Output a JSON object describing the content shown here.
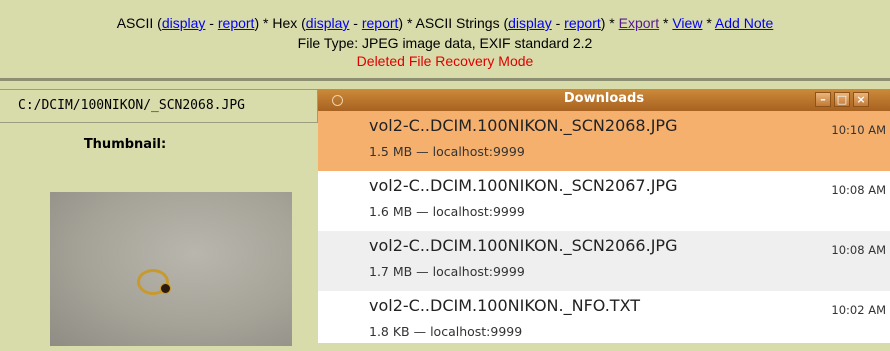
{
  "header": {
    "ascii": "ASCII (",
    "ascii_display": "display",
    "dash1": " - ",
    "ascii_report": "report",
    "hex": ") * Hex (",
    "hex_display": "display",
    "dash2": " - ",
    "hex_report": "report",
    "strings": ") * ASCII Strings (",
    "strings_display": "display",
    "dash3": " - ",
    "strings_report": "report",
    "close_paren": ") * ",
    "export": "Export",
    "star1": " * ",
    "view": "View",
    "star2": " * ",
    "add_note": "Add Note",
    "file_type": "File Type: JPEG image data, EXIF standard 2.2",
    "mode": "Deleted File Recovery Mode"
  },
  "left": {
    "path": "C:/DCIM/100NIKON/_SCN2068.JPG",
    "thumbnail_label": "Thumbnail:"
  },
  "downloads": {
    "title": "Downloads",
    "buttons": {
      "minimize": "–",
      "maximize": "□",
      "close": "×"
    },
    "items": [
      {
        "name": "vol2-C..DCIM.100NIKON._SCN2068.JPG",
        "meta": "1.5 MB — localhost:9999",
        "time": "10:10 AM"
      },
      {
        "name": "vol2-C..DCIM.100NIKON._SCN2067.JPG",
        "meta": "1.6 MB — localhost:9999",
        "time": "10:08 AM"
      },
      {
        "name": "vol2-C..DCIM.100NIKON._SCN2066.JPG",
        "meta": "1.7 MB — localhost:9999",
        "time": "10:08 AM"
      },
      {
        "name": "vol2-C..DCIM.100NIKON._NFO.TXT",
        "meta": "1.8 KB — localhost:9999",
        "time": "10:02 AM"
      }
    ]
  }
}
